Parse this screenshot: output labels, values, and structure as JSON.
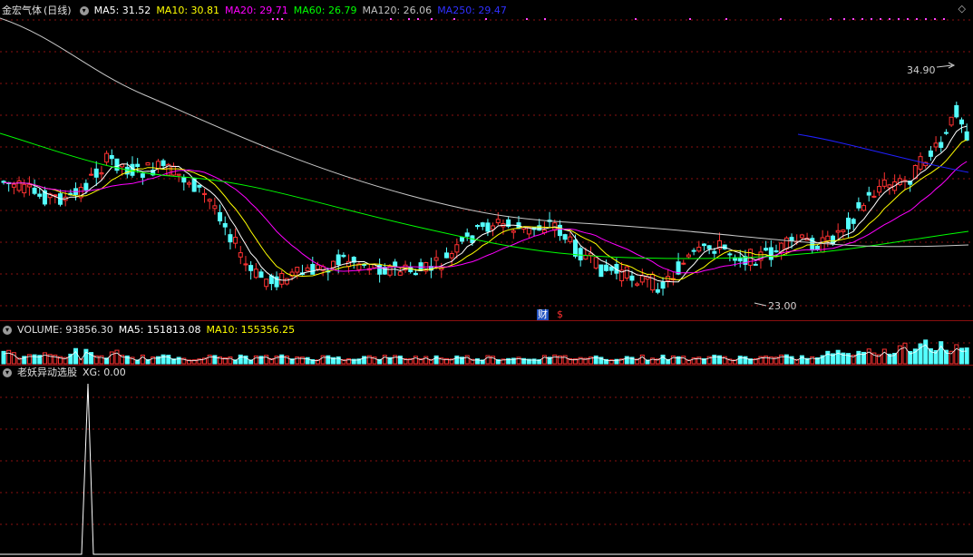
{
  "main": {
    "stock_name": "金宏气体",
    "period": "(日线)",
    "ma_labels": [
      {
        "text": "MA5: 31.52",
        "color": "#ffffff"
      },
      {
        "text": "MA10: 30.81",
        "color": "#ffff00"
      },
      {
        "text": "MA20: 29.71",
        "color": "#ff00ff"
      },
      {
        "text": "MA60: 26.79",
        "color": "#00ff00"
      },
      {
        "text": "MA120: 26.06",
        "color": "#c0c0c0"
      },
      {
        "text": "MA250: 29.47",
        "color": "#2020ff"
      }
    ],
    "high_label": "34.90",
    "low_label": "23.00",
    "markers": {
      "cai": "财",
      "dollar": "$"
    }
  },
  "volume": {
    "title": "VOLUME: 93856.30",
    "ma_labels": [
      {
        "text": "MA5: 151813.08",
        "color": "#ffffff"
      },
      {
        "text": "MA10: 155356.25",
        "color": "#ffff00"
      }
    ]
  },
  "indicator": {
    "title": "老妖异动选股",
    "xg_label": "XG: 0.00"
  },
  "colors": {
    "up": "#ff3232",
    "down": "#54ffff",
    "grid": "#8a1010"
  }
}
